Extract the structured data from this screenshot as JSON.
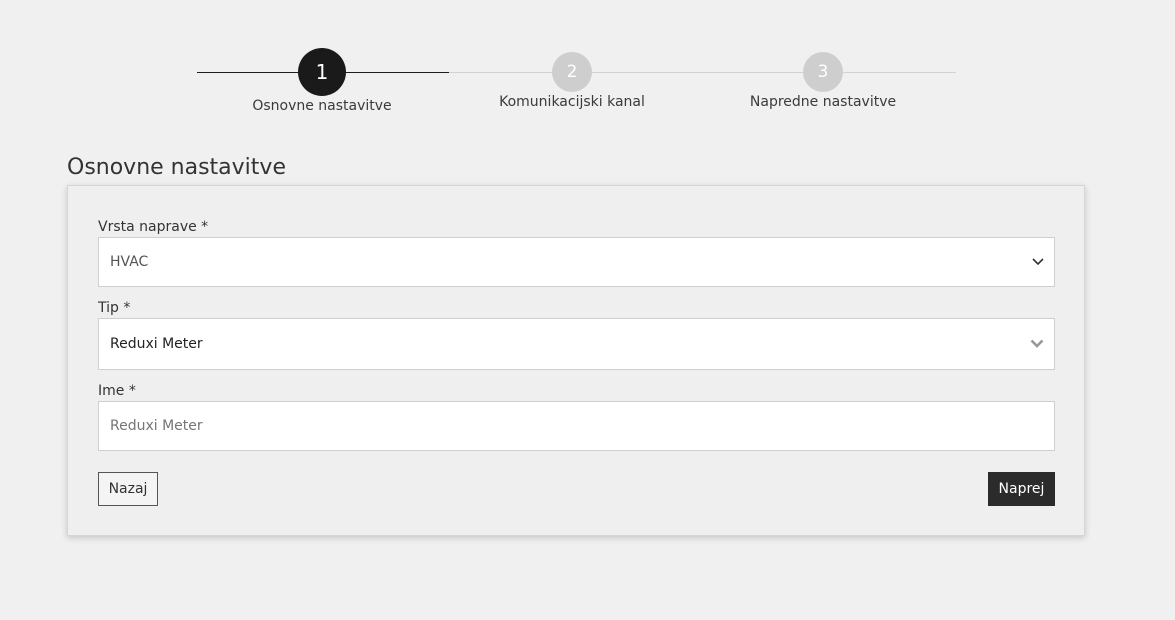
{
  "stepper": {
    "steps": [
      {
        "number": "1",
        "label": "Osnovne nastavitve",
        "state": "active"
      },
      {
        "number": "2",
        "label": "Komunikacijski kanal",
        "state": "inactive"
      },
      {
        "number": "3",
        "label": "Napredne nastavitve",
        "state": "inactive"
      }
    ]
  },
  "page": {
    "title": "Osnovne nastavitve"
  },
  "form": {
    "device_type": {
      "label": "Vrsta naprave *",
      "value": "HVAC",
      "icon": "chevron-down-icon"
    },
    "type": {
      "label": "Tip *",
      "value": "Reduxi Meter",
      "icon": "chevron-down-icon"
    },
    "name": {
      "label": "Ime *",
      "placeholder": "Reduxi Meter",
      "value": ""
    }
  },
  "actions": {
    "back_label": "Nazaj",
    "next_label": "Naprej"
  },
  "colors": {
    "accent_dark": "#1a1a1a",
    "inactive_step": "#cecece",
    "background": "#f0f0f0"
  }
}
